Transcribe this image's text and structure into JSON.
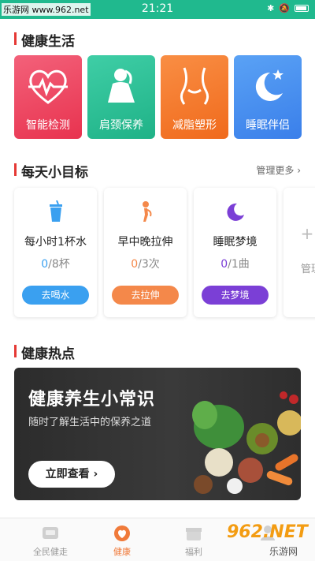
{
  "status_bar": {
    "watermark": "乐游网 www.962.net",
    "time": "21:21",
    "bt": "✱",
    "mute": "🔕"
  },
  "sections": {
    "life": "健康生活",
    "goals": "每天小目标",
    "hot": "健康热点"
  },
  "features": [
    {
      "label": "智能检测",
      "icon": "heart-pulse-icon",
      "color": "#ee4660"
    },
    {
      "label": "肩颈保养",
      "icon": "neck-icon",
      "color": "#27bf96"
    },
    {
      "label": "减脂塑形",
      "icon": "waist-icon",
      "color": "#f47b2a"
    },
    {
      "label": "睡眠伴侣",
      "icon": "moon-star-icon",
      "color": "#4a8ff0"
    }
  ],
  "goals": {
    "manage_more": "管理更多",
    "items": [
      {
        "name": "每小时1杯水",
        "done": "0",
        "total": "/8杯",
        "button": "去喝水",
        "color": "#3aa0f0",
        "icon": "cup-icon"
      },
      {
        "name": "早中晚拉伸",
        "done": "0",
        "total": "/3次",
        "button": "去拉伸",
        "color": "#f4884a",
        "icon": "stretch-icon"
      },
      {
        "name": "睡眠梦境",
        "done": "0",
        "total": "/1曲",
        "button": "去梦境",
        "color": "#7b3fd6",
        "icon": "moon-icon"
      },
      {
        "name": "管理",
        "icon": "plus-icon"
      }
    ]
  },
  "banner": {
    "title": "健康养生小常识",
    "subtitle": "随时了解生活中的保养之道",
    "button": "立即查看"
  },
  "tabs": [
    {
      "label": "全民健走",
      "icon": "walk-icon",
      "active": false
    },
    {
      "label": "健康",
      "icon": "health-icon",
      "active": true
    },
    {
      "label": "福利",
      "icon": "gift-icon",
      "active": false
    },
    {
      "label": "",
      "icon": "user-icon",
      "active": false
    }
  ],
  "site_watermark": {
    "logo": "962.NET",
    "text": "乐游网"
  }
}
